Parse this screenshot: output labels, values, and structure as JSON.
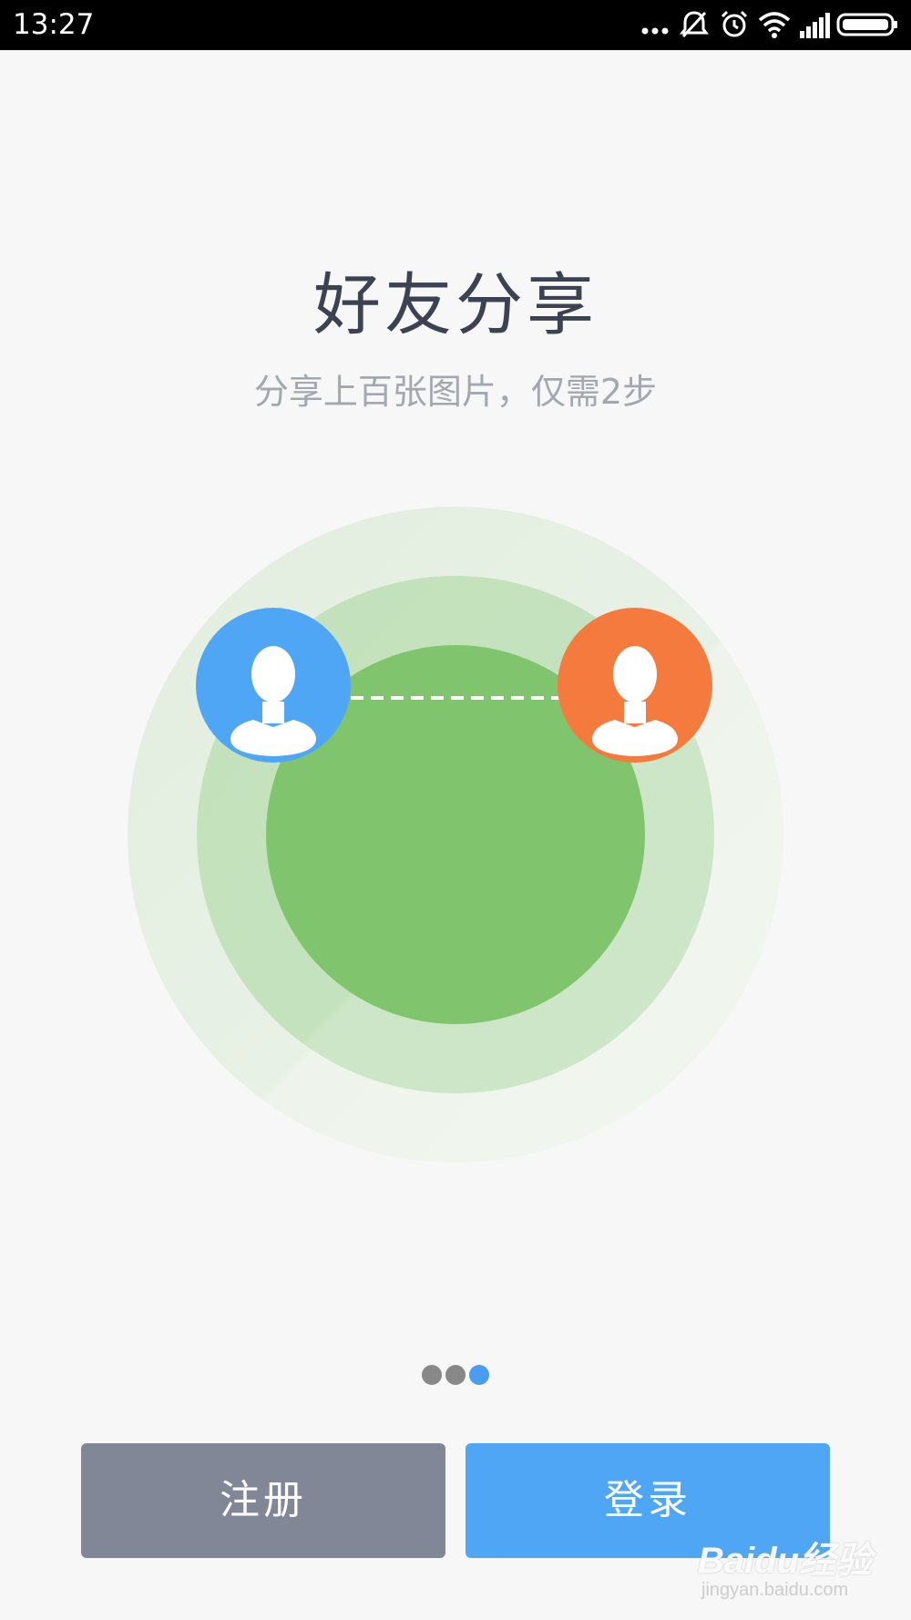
{
  "status_bar": {
    "time": "13:27",
    "icons": [
      "more-dots-icon",
      "bell-off-icon",
      "alarm-icon",
      "wifi-icon",
      "signal-icon",
      "battery-icon"
    ]
  },
  "intro": {
    "title": "好友分享",
    "subtitle": "分享上百张图片，仅需2步"
  },
  "illustration": {
    "left_avatar_color": "#4fa6f5",
    "right_avatar_color": "#f47b3d",
    "inner_circle_color": "#80c56d",
    "middle_ring_color": "#c6e3c0",
    "outer_ring_color": "#e7f0e4"
  },
  "pager": {
    "total": 3,
    "current": 3,
    "active_color": "#4a9cf0"
  },
  "actions": {
    "register_label": "注册",
    "login_label": "登录"
  },
  "watermark": {
    "logo": "Baidu经验",
    "url": "jingyan.baidu.com"
  }
}
